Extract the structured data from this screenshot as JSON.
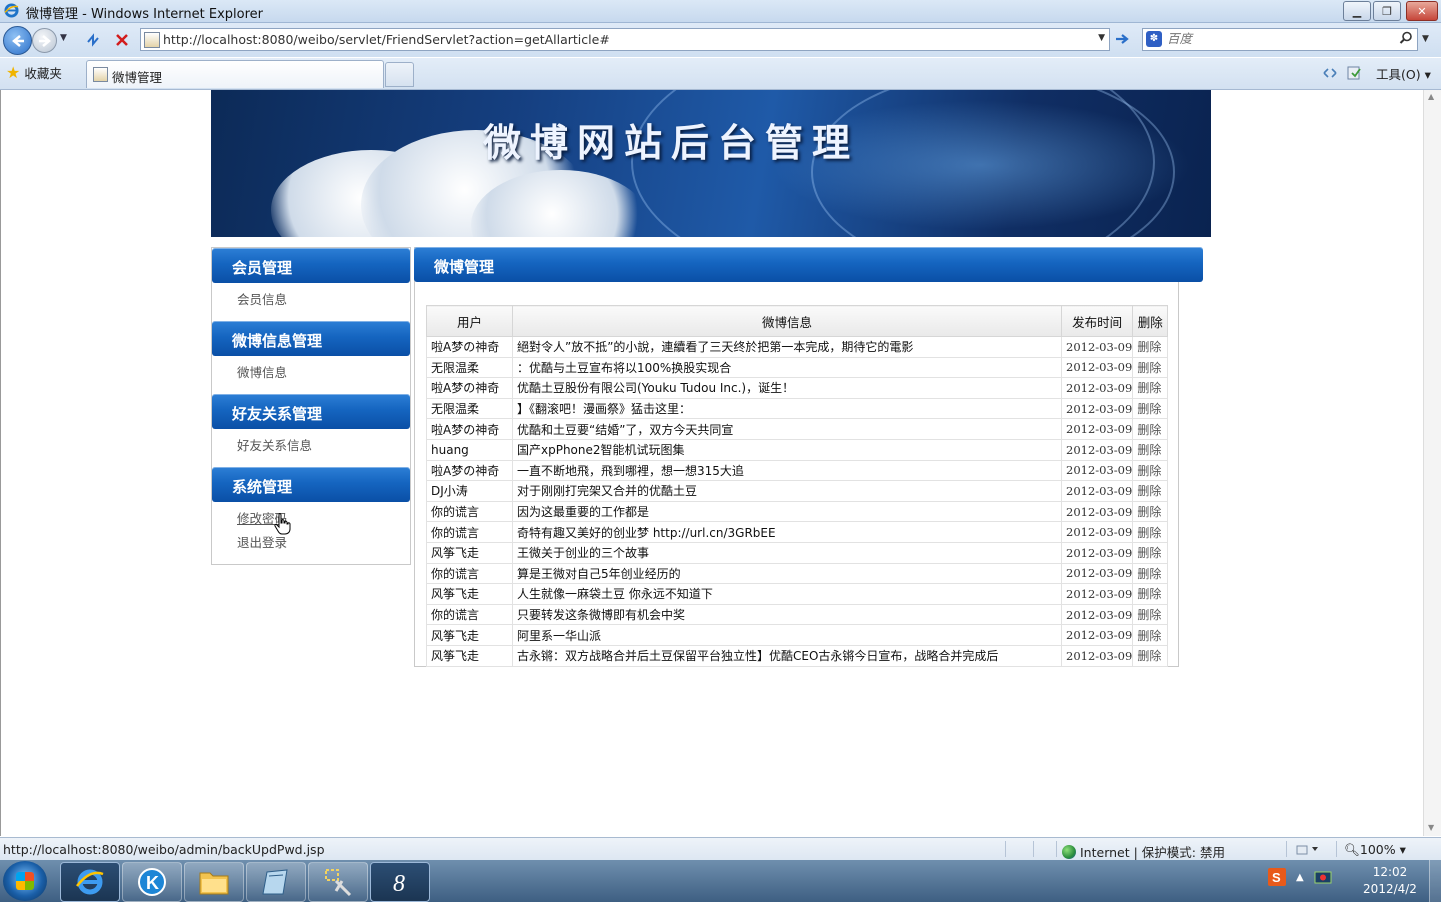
{
  "window": {
    "title": "微博管理 - Windows Internet Explorer"
  },
  "address_bar": {
    "url": "http://localhost:8080/weibo/servlet/FriendServlet?action=getAllarticle#",
    "search_placeholder": "百度"
  },
  "favorites_bar": {
    "favorites_label": "收藏夹",
    "tab_label": "微博管理",
    "tools_label": "工具(O)"
  },
  "banner": {
    "title": "微博网站后台管理"
  },
  "sidebar": {
    "sections": [
      {
        "title": "会员管理",
        "items": [
          "会员信息"
        ]
      },
      {
        "title": "微博信息管理",
        "items": [
          "微博信息"
        ]
      },
      {
        "title": "好友关系管理",
        "items": [
          "好友关系信息"
        ]
      },
      {
        "title": "系统管理",
        "items": [
          "修改密码",
          "退出登录"
        ]
      }
    ]
  },
  "main": {
    "title": "微博管理",
    "columns": [
      "用户",
      "微博信息",
      "发布时间",
      "删除"
    ],
    "rows": [
      {
        "user": "啦A梦の神奇",
        "content": "絕對令人”放不抵”的小說，連續看了三天终於把第一本完成，期待它的電影",
        "date": "2012-03-09",
        "action": "删除"
      },
      {
        "user": "无限温柔",
        "content": "：优酷与土豆宣布将以100%换股实现合",
        "date": "2012-03-09",
        "action": "删除"
      },
      {
        "user": "啦A梦の神奇",
        "content": "优酷土豆股份有限公司(Youku Tudou Inc.)，诞生！",
        "date": "2012-03-09",
        "action": "删除"
      },
      {
        "user": "无限温柔",
        "content": "】《翻滚吧！漫画祭》猛击这里：",
        "date": "2012-03-09",
        "action": "删除"
      },
      {
        "user": "啦A梦の神奇",
        "content": "优酷和土豆要“结婚”了，双方今天共同宣",
        "date": "2012-03-09",
        "action": "删除"
      },
      {
        "user": "huang",
        "content": "国产xpPhone2智能机试玩图集",
        "date": "2012-03-09",
        "action": "删除"
      },
      {
        "user": "啦A梦の神奇",
        "content": "一直不断地飛，飛到哪裡，想一想315大追",
        "date": "2012-03-09",
        "action": "删除"
      },
      {
        "user": "DJ小涛",
        "content": "对于刚刚打完架又合并的优酷土豆",
        "date": "2012-03-09",
        "action": "删除"
      },
      {
        "user": "你的谎言",
        "content": "因为这最重要的工作都是",
        "date": "2012-03-09",
        "action": "删除"
      },
      {
        "user": "你的谎言",
        "content": "奇特有趣又美好的创业梦 http://url.cn/3GRbEE",
        "date": "2012-03-09",
        "action": "删除"
      },
      {
        "user": "风筝飞走",
        "content": "王微关于创业的三个故事",
        "date": "2012-03-09",
        "action": "删除"
      },
      {
        "user": "你的谎言",
        "content": "算是王微对自己5年创业经历的",
        "date": "2012-03-09",
        "action": "删除"
      },
      {
        "user": "风筝飞走",
        "content": "人生就像一麻袋土豆 你永远不知道下",
        "date": "2012-03-09",
        "action": "删除"
      },
      {
        "user": "你的谎言",
        "content": "只要转发这条微博即有机会中奖",
        "date": "2012-03-09",
        "action": "删除"
      },
      {
        "user": "风筝飞走",
        "content": "阿里系一华山派",
        "date": "2012-03-09",
        "action": "删除"
      },
      {
        "user": "风筝飞走",
        "content": "古永锵：双方战略合并后土豆保留平台独立性】优酷CEO古永锵今日宣布，战略合并完成后",
        "date": "2012-03-09",
        "action": "删除"
      }
    ]
  },
  "status_bar": {
    "url": "http://localhost:8080/weibo/admin/backUpdPwd.jsp",
    "zone": "Internet | 保护模式: 禁用",
    "zoom": "100%"
  },
  "taskbar": {
    "time": "12:02",
    "date": "2012/4/2"
  }
}
